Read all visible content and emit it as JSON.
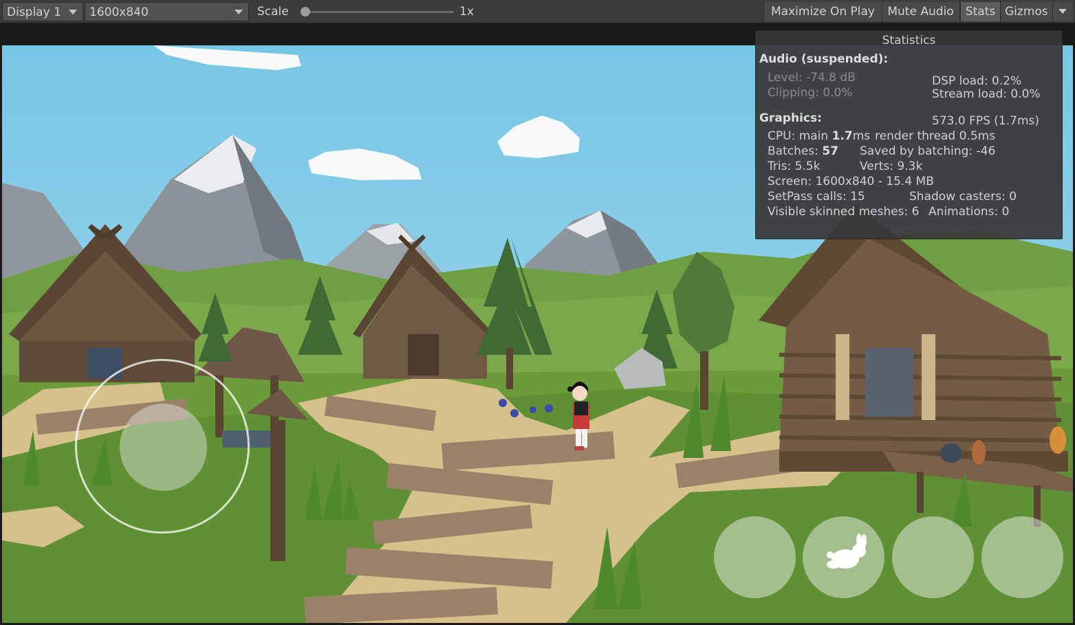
{
  "toolbar": {
    "display": "Display 1",
    "resolution": "1600x840",
    "scale_label": "Scale",
    "scale_value": "1x",
    "scale_fraction": 0,
    "maximize": "Maximize On Play",
    "mute": "Mute Audio",
    "stats": "Stats",
    "gizmos": "Gizmos"
  },
  "stats": {
    "title": "Statistics",
    "audio_header": "Audio (suspended):",
    "level": "Level: -74.8 dB",
    "clipping": "Clipping: 0.0%",
    "dsp": "DSP load: 0.2%",
    "stream": "Stream load: 0.0%",
    "graphics_header": "Graphics:",
    "fps": "573.0 FPS (1.7ms)",
    "cpu_a": "CPU: main ",
    "cpu_b": "1.7",
    "cpu_c": "ms",
    "render": "render thread 0.5ms",
    "batches_a": "Batches: ",
    "batches_b": "57",
    "saved": "Saved by batching: -46",
    "tris": "Tris: 5.5k",
    "verts": "Verts: 9.3k",
    "screen": "Screen: 1600x840 - 15.4 MB",
    "setpass": "SetPass calls: 15",
    "shadow": "Shadow casters: 0",
    "skinned": "Visible skinned meshes: 6",
    "animations": "Animations: 0"
  },
  "controls": {
    "joystick": "virtual-joystick",
    "buttons": [
      "action-button-1",
      "jump-button-rabbit",
      "action-button-3",
      "action-button-4"
    ]
  },
  "colors": {
    "sky": "#86cde6",
    "grass": "#6a9a3a",
    "path": "#d4be8a",
    "wood": "#6b5540",
    "toolbar": "#3c3c3c"
  }
}
